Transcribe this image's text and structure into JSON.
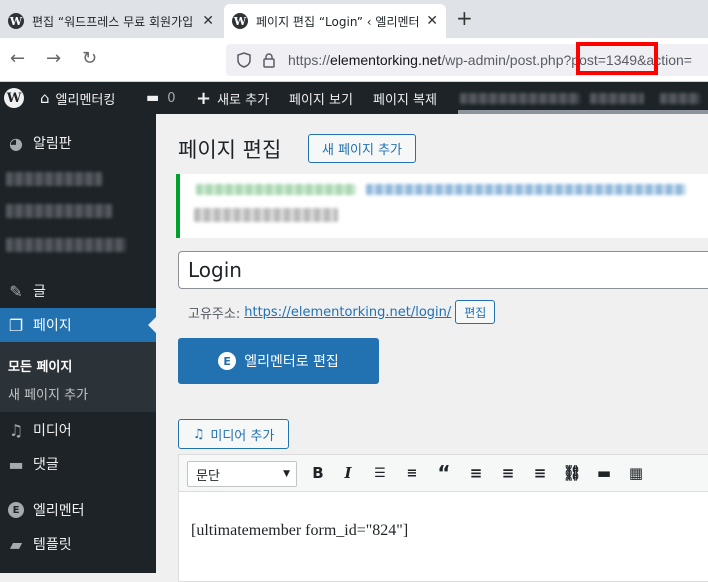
{
  "browser": {
    "tabs": [
      {
        "title": "편집 “워드프레스 무료 회원가입",
        "active": false
      },
      {
        "title": "페이지 편집 “Login” ‹ 엘리멘터",
        "active": true
      }
    ],
    "new_tab_glyph": "+",
    "close_glyph": "✕",
    "url_prefix": "https://",
    "url_host": "elementorking.net",
    "url_path": "/wp-admin/post.php?post=1349&action=",
    "highlight_color": "#ff0000"
  },
  "adminbar": {
    "site_name": "엘리멘터킹",
    "comment_count": "0",
    "new_label": "새로 추가",
    "view_page": "페이지 보기",
    "duplicate_page": "페이지 복제"
  },
  "sidebar": {
    "items": [
      {
        "label": "알림판",
        "icon": "dashboard-icon"
      },
      {
        "label": "글",
        "icon": "pin-icon"
      },
      {
        "label": "페이지",
        "icon": "pages-icon",
        "active": true
      },
      {
        "label": "미디어",
        "icon": "media-icon"
      },
      {
        "label": "댓글",
        "icon": "comment-icon"
      },
      {
        "label": "엘리멘터",
        "icon": "elementor-icon"
      },
      {
        "label": "템플릿",
        "icon": "folder-icon"
      }
    ],
    "submenu": [
      "모든 페이지",
      "새 페이지 추가"
    ],
    "active_color": "#2271b1"
  },
  "main": {
    "page_title": "페이지 편집",
    "add_new": "새 페이지 추가",
    "post_title": "Login",
    "permalink_label": "고유주소:",
    "permalink_url": "https://elementorking.net/login/",
    "edit_permalink": "편집",
    "elementor_button": "엘리멘터로 편집",
    "add_media": "미디어 추가",
    "format_select": "문단",
    "shortcode": "[ultimatemember form_id=\"824\"]"
  }
}
